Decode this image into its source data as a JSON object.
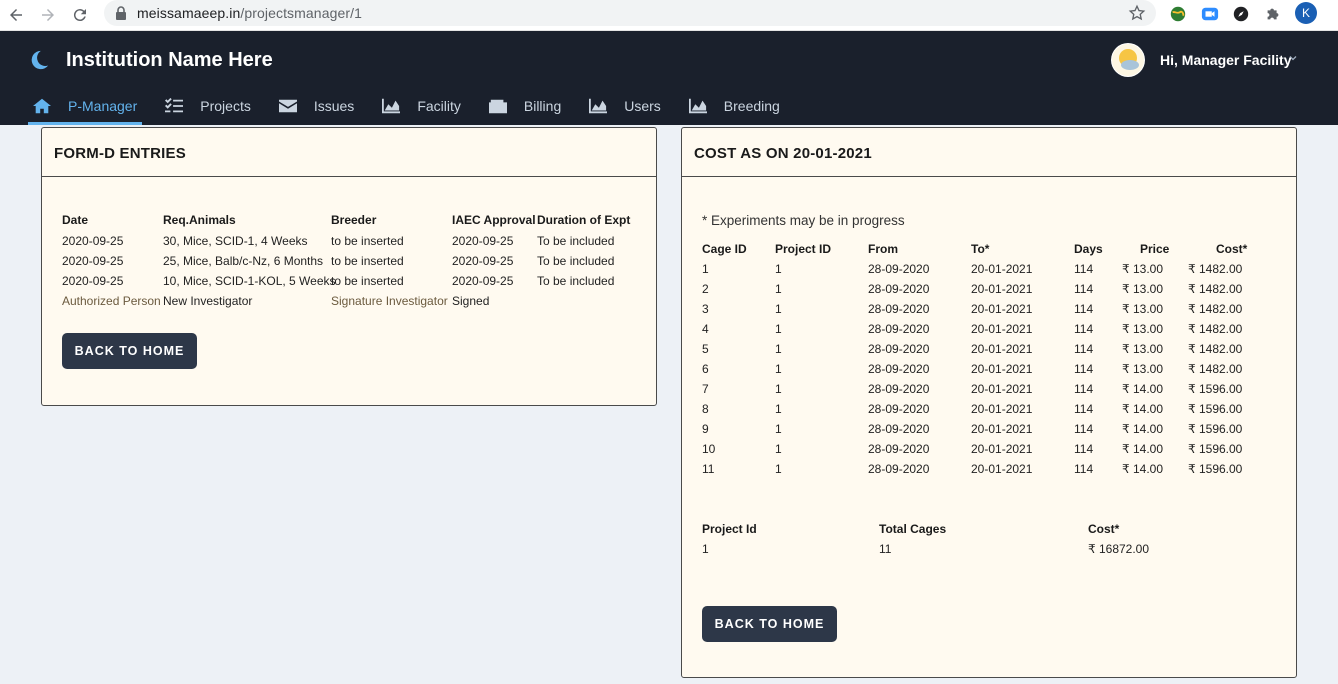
{
  "browser": {
    "url_host": "meissamaeep.in",
    "url_path": "/projectsmanager/1",
    "profile_initial": "K"
  },
  "header": {
    "brand": "Institution Name Here",
    "greeting": "Hi, Manager Facility"
  },
  "nav": {
    "tabs": [
      {
        "label": "P-Manager",
        "icon": "home-icon"
      },
      {
        "label": "Projects",
        "icon": "checklist-icon"
      },
      {
        "label": "Issues",
        "icon": "envelope-icon"
      },
      {
        "label": "Facility",
        "icon": "area-chart-icon"
      },
      {
        "label": "Billing",
        "icon": "wallet-icon"
      },
      {
        "label": "Users",
        "icon": "area-chart-icon"
      },
      {
        "label": "Breeding",
        "icon": "area-chart-icon"
      }
    ],
    "active": "P-Manager"
  },
  "formd": {
    "title": "FORM-D ENTRIES",
    "columns": [
      "Date",
      "Req.Animals",
      "Breeder",
      "IAEC Approval",
      "Duration of Expt"
    ],
    "rows": [
      [
        "2020-09-25",
        "30, Mice, SCID-1, 4 Weeks",
        "to be inserted",
        "2020-09-25",
        "To be included"
      ],
      [
        "2020-09-25",
        "25, Mice, Balb/c-Nz, 6 Months",
        "to be inserted",
        "2020-09-25",
        "To be included"
      ],
      [
        "2020-09-25",
        "10, Mice, SCID-1-KOL, 5 Weeks",
        "to be inserted",
        "2020-09-25",
        "To be included"
      ]
    ],
    "signature_row": [
      "Authorized Person",
      "New Investigator",
      "Signature Investigator",
      "Signed"
    ],
    "back_label": "BACK TO HOME"
  },
  "cost": {
    "title": "COST AS ON 20-01-2021",
    "note": "* Experiments may be in progress",
    "columns": [
      "Cage ID",
      "Project ID",
      "From",
      "To*",
      "Days",
      "Price",
      "Cost*"
    ],
    "rows": [
      [
        "1",
        "1",
        "28-09-2020",
        "20-01-2021",
        "114",
        "₹ 13.00",
        "₹ 1482.00"
      ],
      [
        "2",
        "1",
        "28-09-2020",
        "20-01-2021",
        "114",
        "₹ 13.00",
        "₹ 1482.00"
      ],
      [
        "3",
        "1",
        "28-09-2020",
        "20-01-2021",
        "114",
        "₹ 13.00",
        "₹ 1482.00"
      ],
      [
        "4",
        "1",
        "28-09-2020",
        "20-01-2021",
        "114",
        "₹ 13.00",
        "₹ 1482.00"
      ],
      [
        "5",
        "1",
        "28-09-2020",
        "20-01-2021",
        "114",
        "₹ 13.00",
        "₹ 1482.00"
      ],
      [
        "6",
        "1",
        "28-09-2020",
        "20-01-2021",
        "114",
        "₹ 13.00",
        "₹ 1482.00"
      ],
      [
        "7",
        "1",
        "28-09-2020",
        "20-01-2021",
        "114",
        "₹ 14.00",
        "₹ 1596.00"
      ],
      [
        "8",
        "1",
        "28-09-2020",
        "20-01-2021",
        "114",
        "₹ 14.00",
        "₹ 1596.00"
      ],
      [
        "9",
        "1",
        "28-09-2020",
        "20-01-2021",
        "114",
        "₹ 14.00",
        "₹ 1596.00"
      ],
      [
        "10",
        "1",
        "28-09-2020",
        "20-01-2021",
        "114",
        "₹ 14.00",
        "₹ 1596.00"
      ],
      [
        "11",
        "1",
        "28-09-2020",
        "20-01-2021",
        "114",
        "₹ 14.00",
        "₹ 1596.00"
      ]
    ],
    "summary_columns": [
      "Project Id",
      "Total Cages",
      "Cost*"
    ],
    "summary_row": [
      "1",
      "11",
      "₹ 16872.00"
    ],
    "back_label": "BACK TO HOME"
  }
}
